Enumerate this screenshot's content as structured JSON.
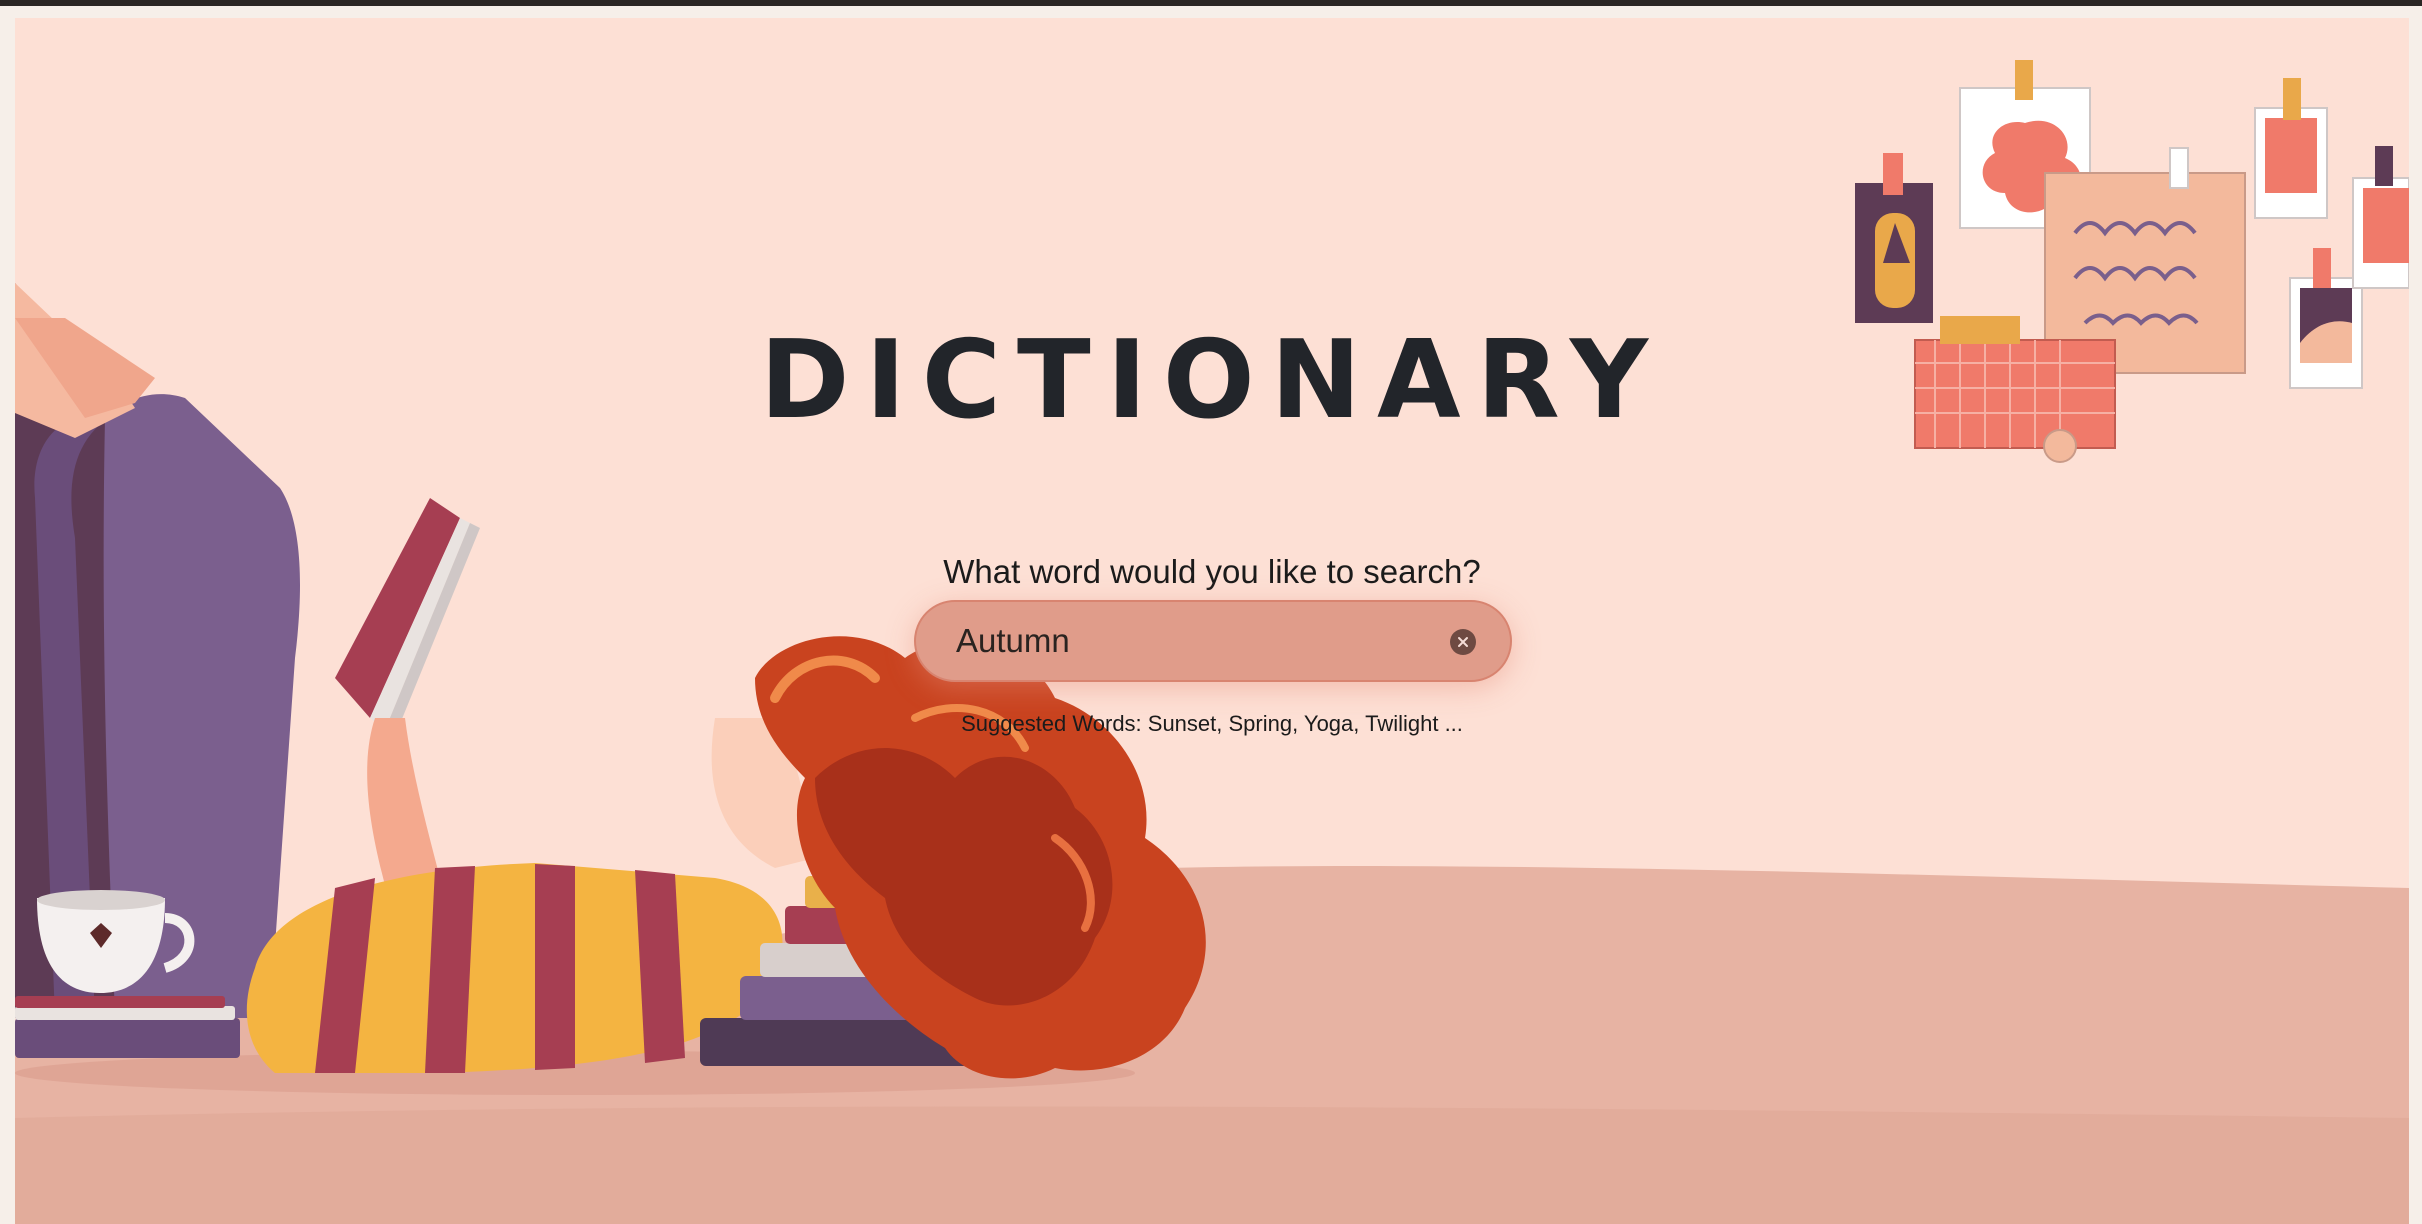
{
  "app": {
    "title": "DICTIONARY"
  },
  "search": {
    "prompt": "What word would you like to search?",
    "value": "Autumn",
    "placeholder": "",
    "clear_icon": "close-circle-icon"
  },
  "suggestions": {
    "text": "Suggested Words: Sunset, Spring, Yoga, Twilight ..."
  },
  "illustration": {
    "subject": "girl-reading-on-floor",
    "palette": {
      "background": "#fde0d5",
      "floor": "#e6b0a0",
      "accent": "#e09c8a",
      "hair": "#c9431f",
      "shirt_yellow": "#f4b441",
      "shirt_stripe": "#a63e52",
      "pants": "#7a5f8c"
    }
  }
}
